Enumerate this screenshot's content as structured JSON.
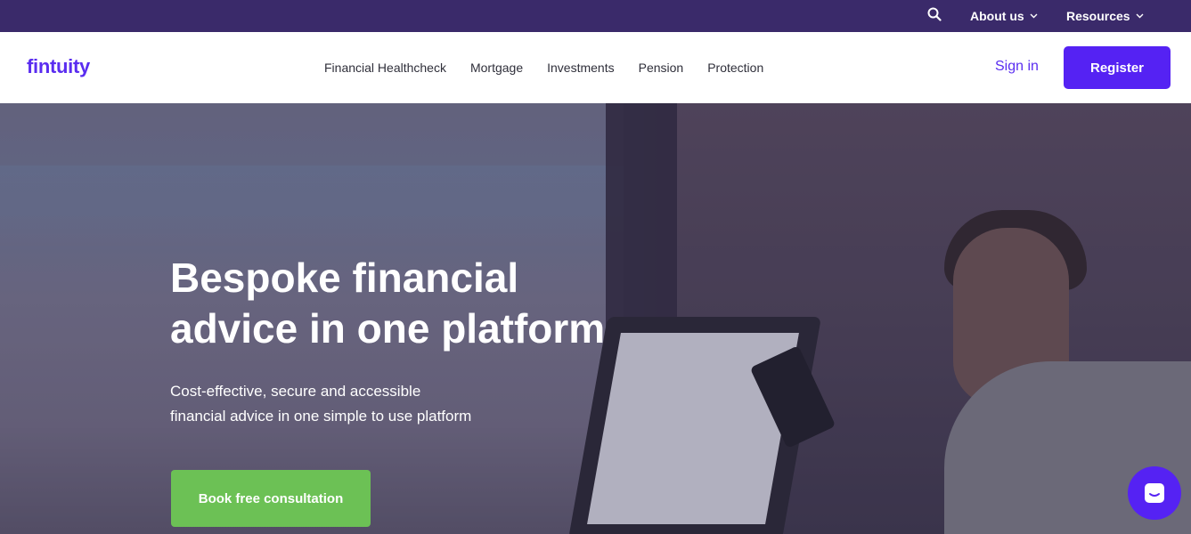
{
  "topbar": {
    "bg_color": "#3a2a6a",
    "search_icon": "search-icon",
    "about_label": "About us",
    "resources_label": "Resources"
  },
  "header": {
    "logo_text": "fintuity",
    "brand_color": "#5a2df0",
    "nav": [
      {
        "label": "Financial Healthcheck"
      },
      {
        "label": "Mortgage"
      },
      {
        "label": "Investments"
      },
      {
        "label": "Pension"
      },
      {
        "label": "Protection"
      }
    ],
    "sign_in_label": "Sign in",
    "register_label": "Register"
  },
  "hero": {
    "title_line1": "Bespoke financial",
    "title_line2": "advice in one platform",
    "subtitle_line1": "Cost-effective, secure and accessible",
    "subtitle_line2": "financial advice in one simple to use platform",
    "cta_label": "Book free consultation",
    "cta_color": "#6cc155"
  },
  "chat": {
    "icon": "chat-icon"
  }
}
